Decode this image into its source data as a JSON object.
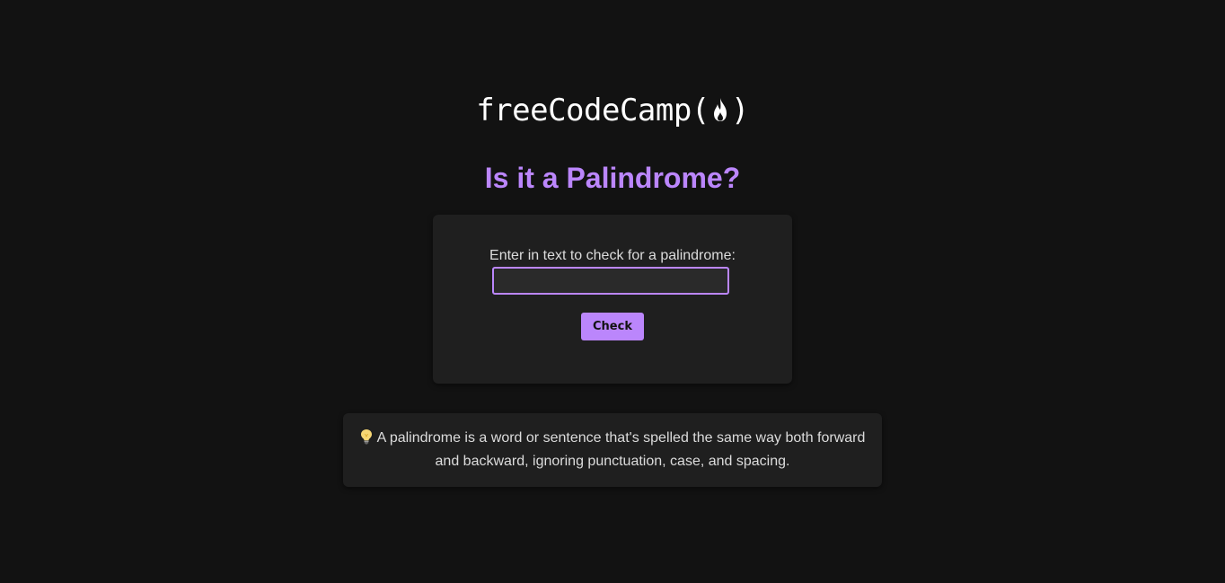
{
  "header": {
    "logo_text": "freeCodeCamp",
    "logo_open_paren": "(",
    "logo_close_paren": ")"
  },
  "title": "Is it a Palindrome?",
  "form": {
    "label": "Enter in text to check for a palindrome:",
    "input_value": "",
    "input_placeholder": "",
    "check_button": "Check"
  },
  "info": {
    "icon": "lightbulb-icon",
    "text": "A palindrome is a word or sentence that's spelled the same way both forward and backward, ignoring punctuation, case, and spacing."
  },
  "colors": {
    "background": "#121212",
    "card": "#1f1f1f",
    "accent": "#bb86fc",
    "text": "#dcdcdc"
  }
}
